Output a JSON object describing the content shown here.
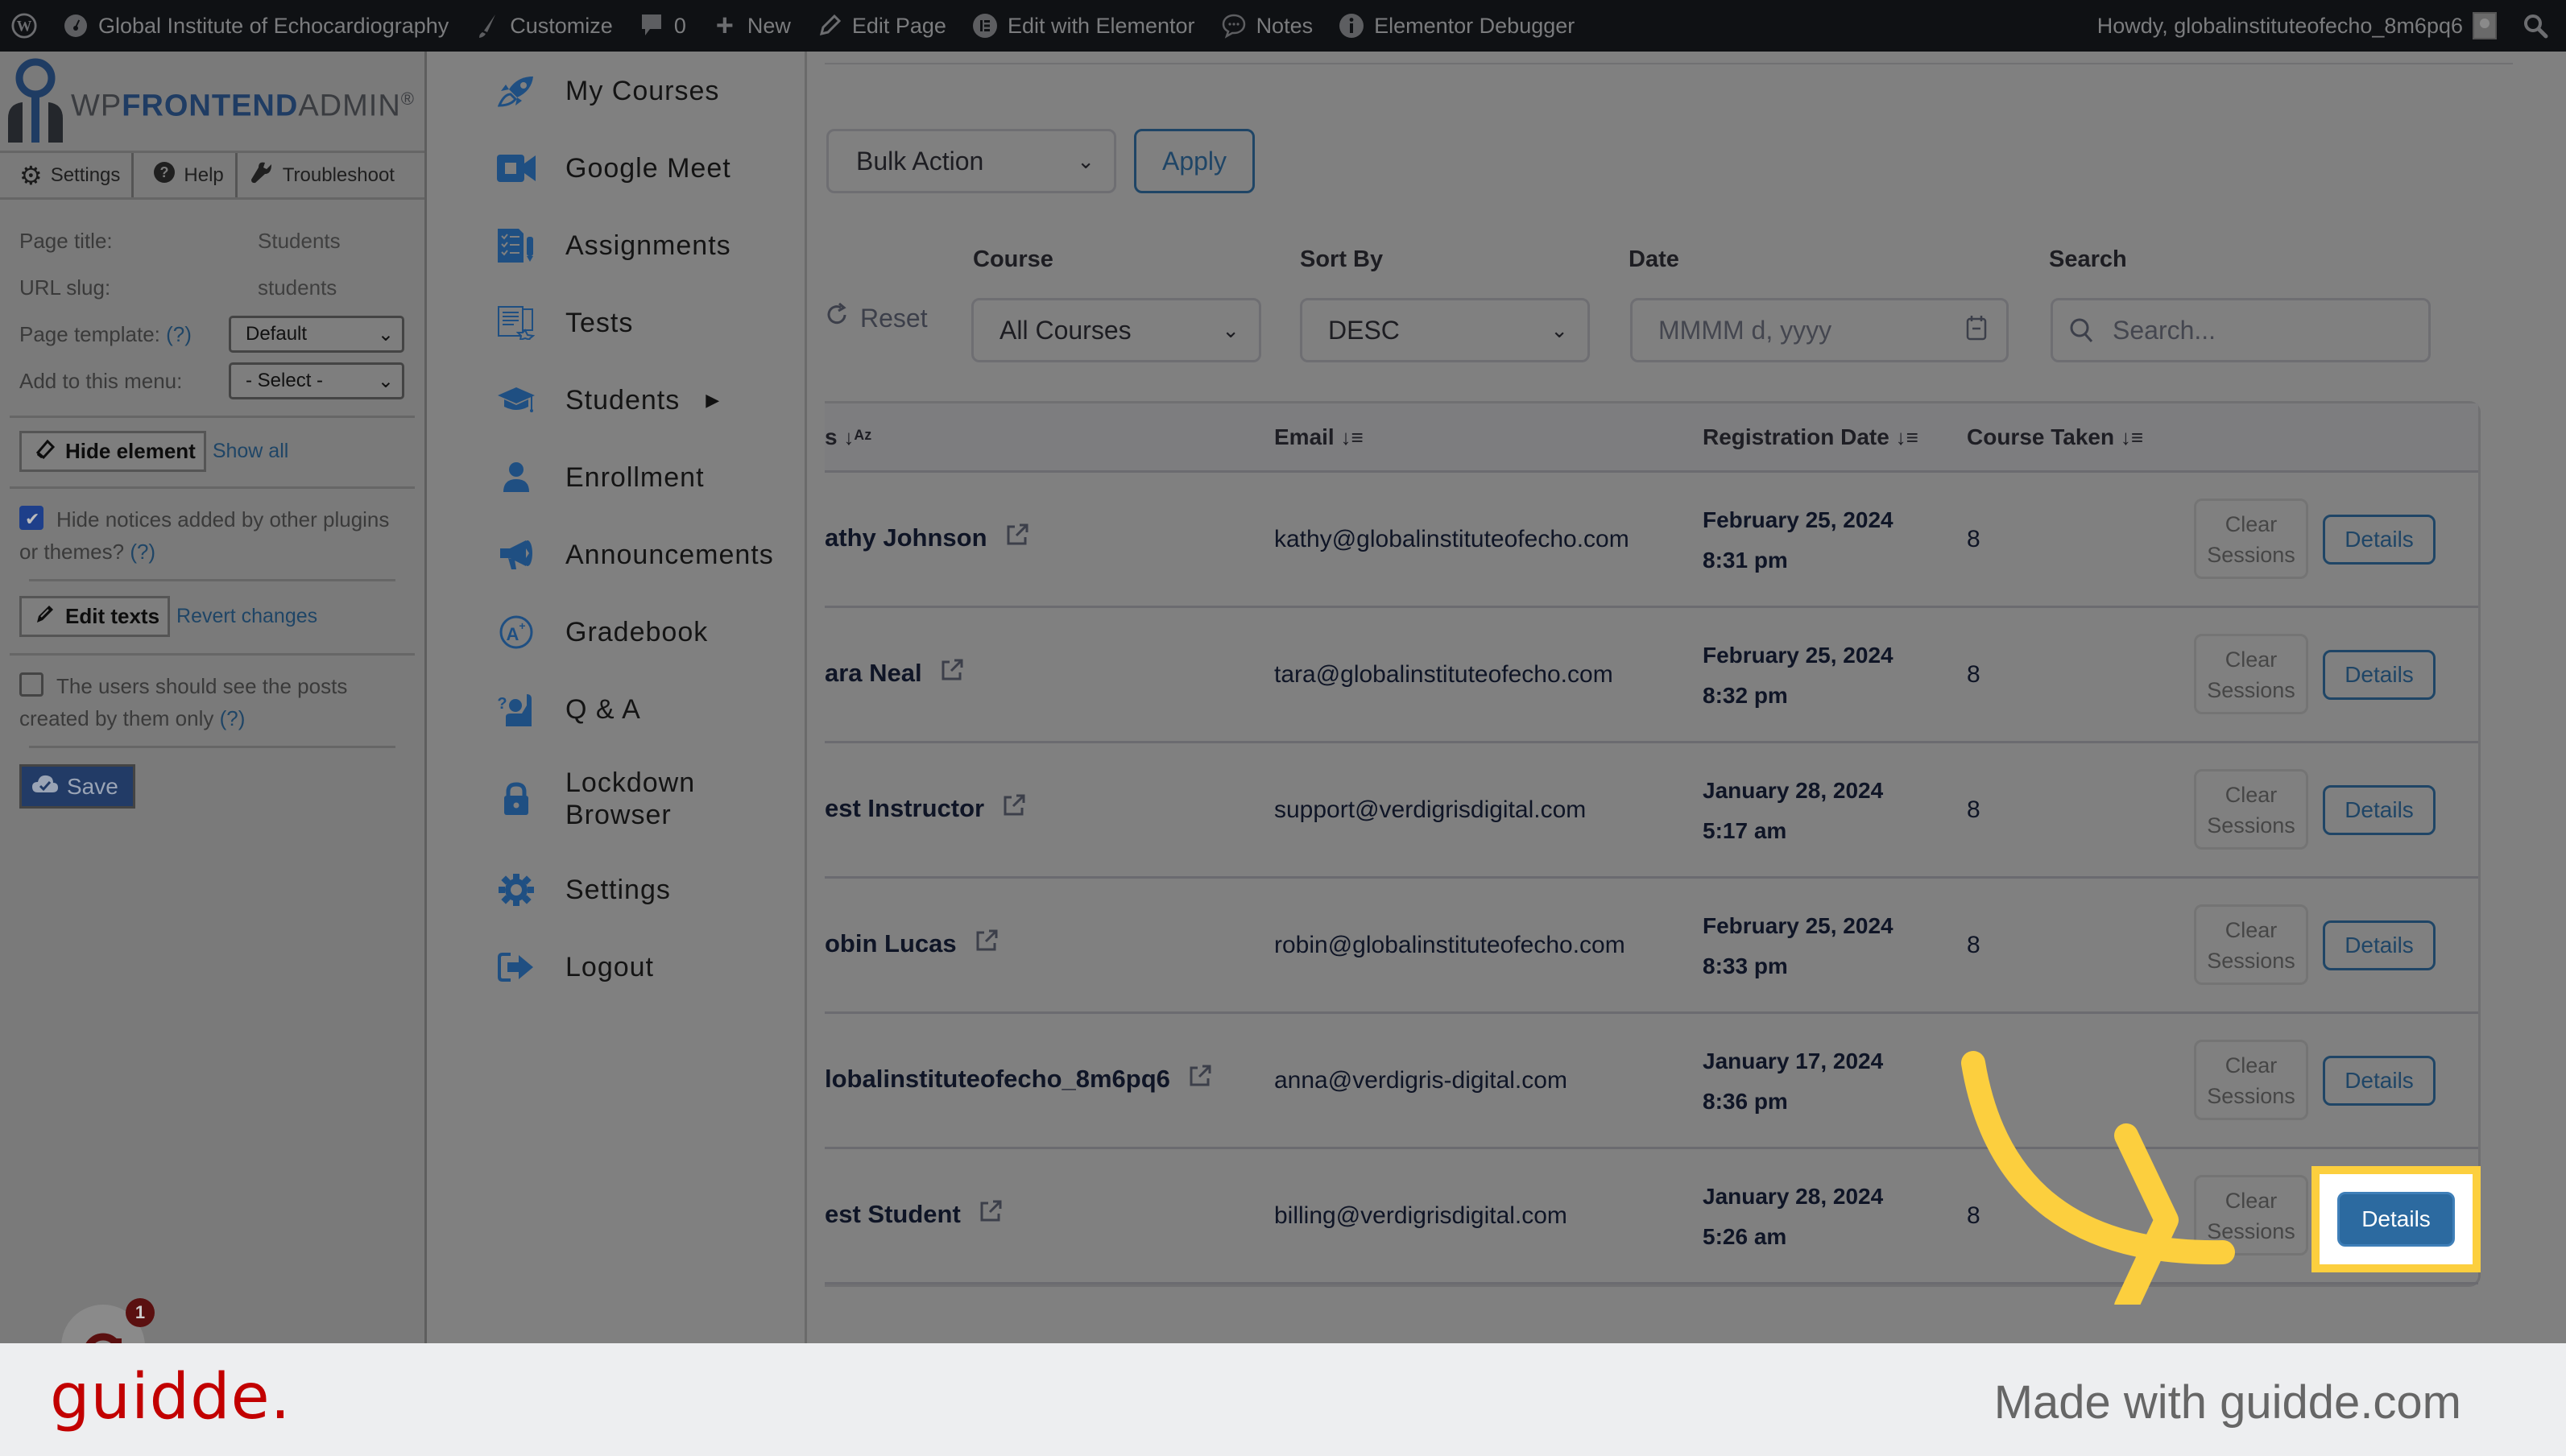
{
  "adminbar": {
    "site_name": "Global Institute of Echocardiography",
    "customize": "Customize",
    "comments_count": "0",
    "new": "New",
    "edit_page": "Edit Page",
    "edit_with_elementor": "Edit with Elementor",
    "notes": "Notes",
    "elementor_debugger": "Elementor Debugger",
    "howdy": "Howdy, globalinstituteofecho_8m6pq6"
  },
  "wpfa": {
    "logo_prefix": "WP",
    "logo_bold": "FRONTEND",
    "logo_suffix": "ADMIN",
    "logo_reg": "®",
    "tabs": [
      "Settings",
      "Help",
      "Troubleshoot"
    ],
    "page_title_label": "Page title:",
    "page_title_value": "Students",
    "url_slug_label": "URL slug:",
    "url_slug_value": "students",
    "page_template_label": "Page template:",
    "help_marker": "(?)",
    "page_template_value": "Default",
    "add_menu_label": "Add to this menu:",
    "add_menu_value": "- Select -",
    "hide_element": "Hide element",
    "show_all": "Show all",
    "hide_notices_label": "Hide notices added by other plugins or themes?",
    "hide_notices_checked": true,
    "edit_texts": "Edit texts",
    "revert_changes": "Revert changes",
    "own_posts_label": "The users should see the posts created by them only",
    "own_posts_checked": false,
    "save": "Save"
  },
  "nav": {
    "items": [
      {
        "label": "My Courses",
        "icon": "rocket-icon"
      },
      {
        "label": "Google Meet",
        "icon": "video-camera-icon"
      },
      {
        "label": "Assignments",
        "icon": "checklist-icon"
      },
      {
        "label": "Tests",
        "icon": "test-document-icon"
      },
      {
        "label": "Students",
        "icon": "graduation-cap-icon",
        "has_submenu": true
      },
      {
        "label": "Enrollment",
        "icon": "user-icon"
      },
      {
        "label": "Announcements",
        "icon": "megaphone-icon"
      },
      {
        "label": "Gradebook",
        "icon": "grade-a-plus-icon"
      },
      {
        "label": "Q & A",
        "icon": "raised-hand-question-icon"
      },
      {
        "label": "Lockdown Browser",
        "icon": "lock-icon"
      },
      {
        "label": "Settings",
        "icon": "gear-icon"
      },
      {
        "label": "Logout",
        "icon": "logout-icon"
      }
    ]
  },
  "main": {
    "bulk_action": "Bulk Action",
    "apply": "Apply",
    "reset": "Reset",
    "filters": {
      "course_label": "Course",
      "course_value": "All Courses",
      "sort_label": "Sort By",
      "sort_value": "DESC",
      "date_label": "Date",
      "date_placeholder": "MMMM d, yyyy",
      "search_label": "Search",
      "search_placeholder": "Search..."
    },
    "columns": {
      "name": "s",
      "email": "Email",
      "registration_date": "Registration Date",
      "course_taken": "Course Taken"
    },
    "clear_line1": "Clear",
    "clear_line2": "Sessions",
    "details": "Details",
    "rows": [
      {
        "name": "athy Johnson",
        "email": "kathy@globalinstituteofecho.com",
        "date": "February 25, 2024",
        "time": "8:31 pm",
        "courses": "8"
      },
      {
        "name": "ara Neal",
        "email": "tara@globalinstituteofecho.com",
        "date": "February 25, 2024",
        "time": "8:32 pm",
        "courses": "8"
      },
      {
        "name": "est Instructor",
        "email": "support@verdigrisdigital.com",
        "date": "January 28, 2024",
        "time": "5:17 am",
        "courses": "8"
      },
      {
        "name": "obin Lucas",
        "email": "robin@globalinstituteofecho.com",
        "date": "February 25, 2024",
        "time": "8:33 pm",
        "courses": "8"
      },
      {
        "name": "lobalinstituteofecho_8m6pq6",
        "email": "anna@verdigris-digital.com",
        "date": "January 17, 2024",
        "time": "8:36 pm",
        "courses": "8"
      },
      {
        "name": "est Student",
        "email": "billing@verdigrisdigital.com",
        "date": "January 28, 2024",
        "time": "5:26 am",
        "courses": "8"
      }
    ]
  },
  "notification_badge": "1",
  "footer": {
    "logo": "guidde.",
    "made_with": "Made with guidde.com"
  },
  "colors": {
    "highlight": "#fccf3e",
    "primary_button": "#2c6aa0",
    "brand_red": "#c20000",
    "icon_blue": "#1f4f82"
  }
}
